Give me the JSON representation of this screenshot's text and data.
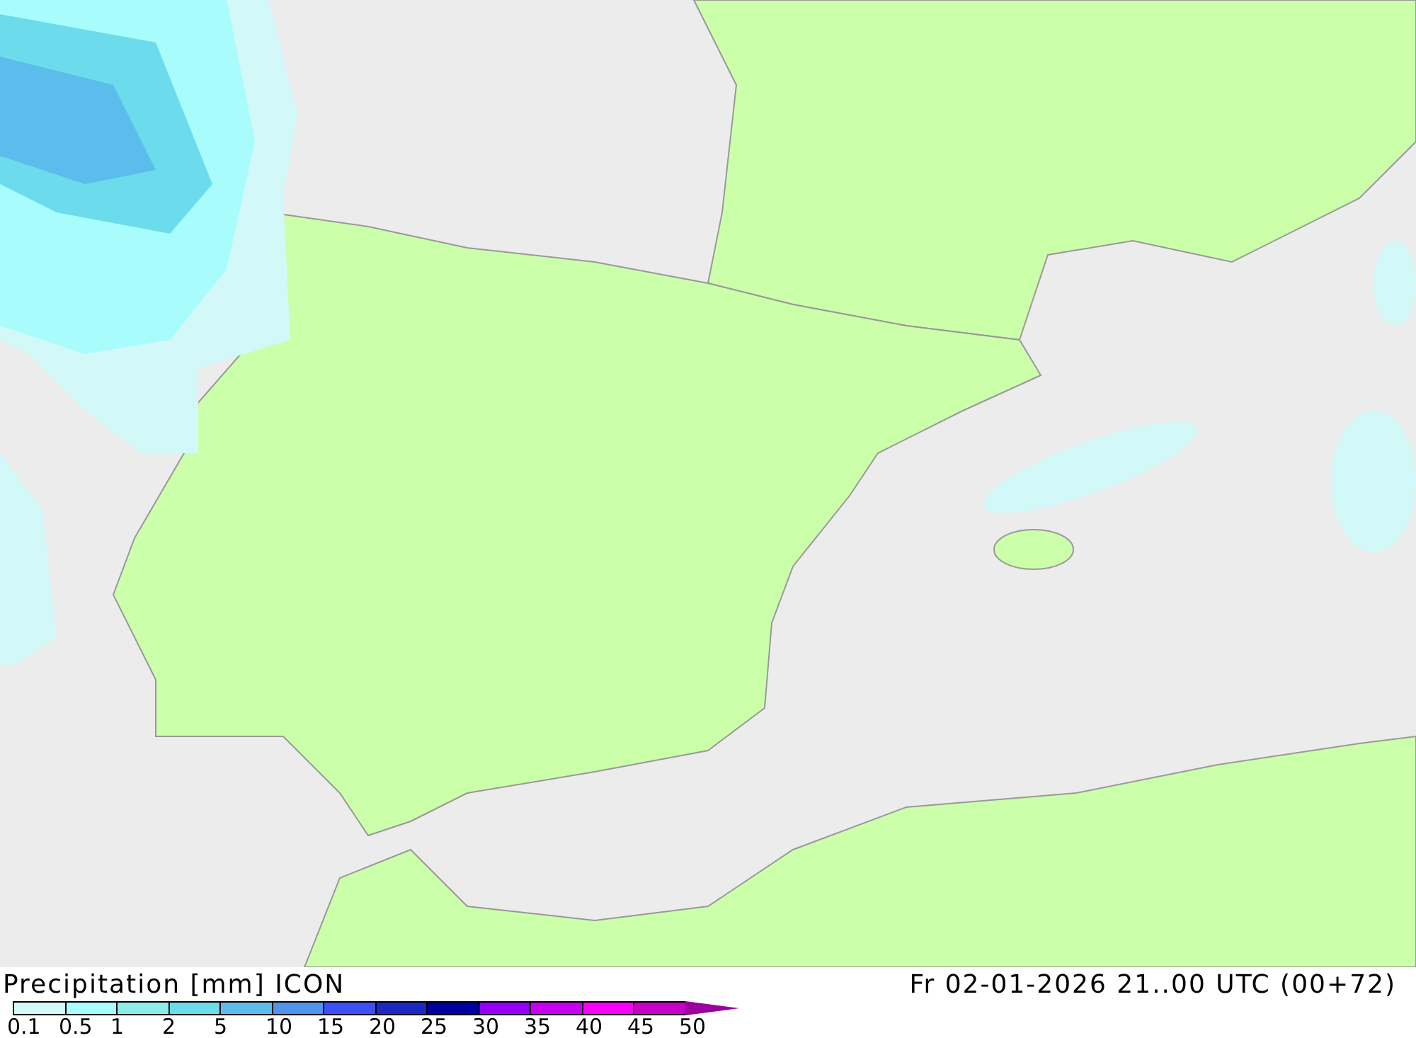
{
  "title": "Precipitation [mm] ICON",
  "valid_time": "Fr 02-01-2026 21..00 UTC (00+72)",
  "legend": {
    "items": [
      {
        "kind": "swatch",
        "label": "0.1",
        "color": "#d2f8f8"
      },
      {
        "kind": "swatch",
        "label": "0.5",
        "color": "#a8fcfc"
      },
      {
        "kind": "swatch",
        "label": "1",
        "color": "#8cecec"
      },
      {
        "kind": "swatch",
        "label": "2",
        "color": "#6cdcec"
      },
      {
        "kind": "swatch",
        "label": "5",
        "color": "#5cbcec"
      },
      {
        "kind": "swatch",
        "label": "10",
        "color": "#5094ec"
      },
      {
        "kind": "swatch",
        "label": "15",
        "color": "#3c50f4"
      },
      {
        "kind": "swatch",
        "label": "20",
        "color": "#1c28c4"
      },
      {
        "kind": "swatch",
        "label": "25",
        "color": "#0000a0"
      },
      {
        "kind": "swatch",
        "label": "30",
        "color": "#9600fa"
      },
      {
        "kind": "swatch",
        "label": "35",
        "color": "#c800f0"
      },
      {
        "kind": "swatch",
        "label": "40",
        "color": "#fa00fa"
      },
      {
        "kind": "swatch",
        "label": "45",
        "color": "#c800c8"
      },
      {
        "kind": "arrow",
        "label": "50",
        "color": "#9a009a"
      }
    ]
  }
}
